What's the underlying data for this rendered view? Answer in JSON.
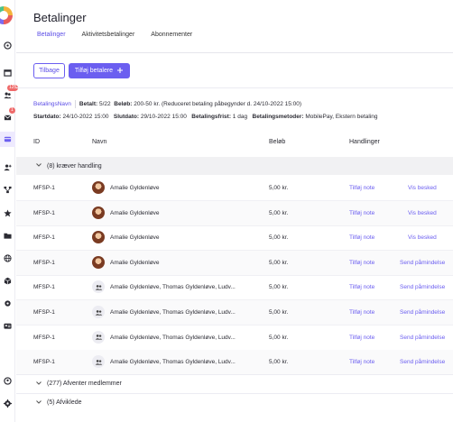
{
  "sidebar": {
    "icons": [
      "dashboard-icon",
      "calendar-icon",
      "users-icon",
      "mail-icon",
      "payments-icon",
      "member-add-icon",
      "hierarchy-icon",
      "star-icon",
      "folder-icon",
      "globe-icon",
      "cube-icon",
      "settings-cog-icon",
      "id-card-icon",
      "help-icon",
      "settings-icon"
    ],
    "badges": {
      "users": "125",
      "mail": "1"
    }
  },
  "page": {
    "title": "Betalinger",
    "tabs": [
      {
        "label": "Betalinger",
        "active": true
      },
      {
        "label": "Aktivitetsbetalinger",
        "active": false
      },
      {
        "label": "Abonnementer",
        "active": false
      }
    ]
  },
  "actions": {
    "back_label": "Tilbage",
    "add_label": "Tilføj betalere",
    "add_icon": "plus-icon"
  },
  "info": {
    "name_link": "BetalingsNavn",
    "paid_label": "Betalt:",
    "paid_value": "5/22",
    "amount_label": "Beløb:",
    "amount_value": "200-50 kr. (Reduceret betaling påbegynder d. 24/10-2022 15:00)",
    "start_label": "Startdato:",
    "start_value": "24/10-2022 15:00",
    "end_label": "Slutdato:",
    "end_value": "29/10-2022 15:00",
    "deadline_label": "Betalingsfrist:",
    "deadline_value": "1 dag",
    "methods_label": "Betalingsmetoder:",
    "methods_value": "MobilePay, Ekstern betaling"
  },
  "table": {
    "headers": {
      "id": "ID",
      "name": "Navn",
      "amount": "Beløb",
      "actions": "Handlinger"
    },
    "groups": [
      {
        "label": "(8) kræver handling",
        "expanded": true
      },
      {
        "label": "(277) Afventer medlemmer",
        "expanded": false
      },
      {
        "label": "(5) Afviklede",
        "expanded": false
      }
    ],
    "rows": [
      {
        "id": "MFSP-1",
        "name": "Amalie Gyldenløve",
        "avatar": "photo",
        "amount": "5,00 kr.",
        "action1": "Tilføj note",
        "action2": "Vis besked"
      },
      {
        "id": "MFSP-1",
        "name": "Amalie Gyldenløve",
        "avatar": "photo",
        "amount": "5,00 kr.",
        "action1": "Tilføj note",
        "action2": "Vis besked"
      },
      {
        "id": "MFSP-1",
        "name": "Amalie Gyldenløve",
        "avatar": "photo",
        "amount": "5,00 kr.",
        "action1": "Tilføj note",
        "action2": "Vis besked"
      },
      {
        "id": "MFSP-1",
        "name": "Amalie Gyldenløve",
        "avatar": "photo",
        "amount": "5,00 kr.",
        "action1": "Tilføj note",
        "action2": "Send påmindelse"
      },
      {
        "id": "MFSP-1",
        "name": "Amalie Gyldenløve, Thomas Gyldenløve, Ludv...",
        "avatar": "group",
        "amount": "5,00 kr.",
        "action1": "Tilføj note",
        "action2": "Send påmindelse"
      },
      {
        "id": "MFSP-1",
        "name": "Amalie Gyldenløve, Thomas Gyldenløve, Ludv...",
        "avatar": "group",
        "amount": "5,00 kr.",
        "action1": "Tilføj note",
        "action2": "Send påmindelse"
      },
      {
        "id": "MFSP-1",
        "name": "Amalie Gyldenløve, Thomas Gyldenløve, Ludv...",
        "avatar": "group",
        "amount": "5,00 kr.",
        "action1": "Tilføj note",
        "action2": "Send påmindelse"
      },
      {
        "id": "MFSP-1",
        "name": "Amalie Gyldenløve, Thomas Gyldenløve, Ludv...",
        "avatar": "group",
        "amount": "5,00 kr.",
        "action1": "Tilføj note",
        "action2": "Send påmindelse"
      }
    ]
  }
}
